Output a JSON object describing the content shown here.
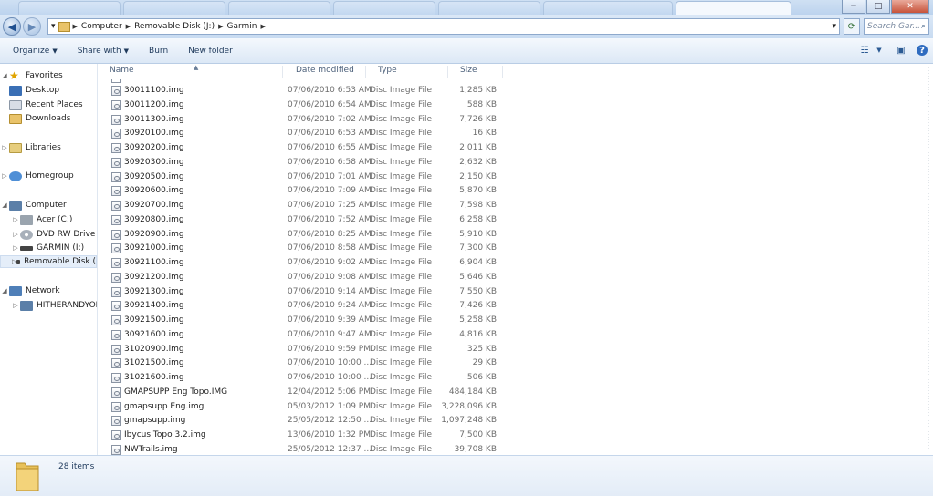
{
  "window": {
    "controls": {
      "minimize": "─",
      "maximize": "□",
      "close": "✕"
    }
  },
  "address": {
    "segments": [
      "Computer",
      "Removable Disk (J:)",
      "Garmin"
    ],
    "search_placeholder": "Search Gar..."
  },
  "toolbar": {
    "organize": "Organize",
    "share_with": "Share with",
    "burn": "Burn",
    "new_folder": "New folder"
  },
  "nav": {
    "favorites": "Favorites",
    "desktop": "Desktop",
    "recent_places": "Recent Places",
    "downloads": "Downloads",
    "libraries": "Libraries",
    "homegroup": "Homegroup",
    "computer": "Computer",
    "acer": "Acer (C:)",
    "dvd": "DVD RW Drive (D",
    "garmin": "GARMIN (I:)",
    "removable": "Removable Disk (",
    "network": "Network",
    "hitherandyon": "HITHERANDYON"
  },
  "columns": {
    "name": "Name",
    "date": "Date modified",
    "type": "Type",
    "size": "Size"
  },
  "files": [
    {
      "name": "30011100.img",
      "date": "07/06/2010 6:53 AM",
      "type": "Disc Image File",
      "size": "1,285 KB"
    },
    {
      "name": "30011200.img",
      "date": "07/06/2010 6:54 AM",
      "type": "Disc Image File",
      "size": "588 KB"
    },
    {
      "name": "30011300.img",
      "date": "07/06/2010 7:02 AM",
      "type": "Disc Image File",
      "size": "7,726 KB"
    },
    {
      "name": "30920100.img",
      "date": "07/06/2010 6:53 AM",
      "type": "Disc Image File",
      "size": "16 KB"
    },
    {
      "name": "30920200.img",
      "date": "07/06/2010 6:55 AM",
      "type": "Disc Image File",
      "size": "2,011 KB"
    },
    {
      "name": "30920300.img",
      "date": "07/06/2010 6:58 AM",
      "type": "Disc Image File",
      "size": "2,632 KB"
    },
    {
      "name": "30920500.img",
      "date": "07/06/2010 7:01 AM",
      "type": "Disc Image File",
      "size": "2,150 KB"
    },
    {
      "name": "30920600.img",
      "date": "07/06/2010 7:09 AM",
      "type": "Disc Image File",
      "size": "5,870 KB"
    },
    {
      "name": "30920700.img",
      "date": "07/06/2010 7:25 AM",
      "type": "Disc Image File",
      "size": "7,598 KB"
    },
    {
      "name": "30920800.img",
      "date": "07/06/2010 7:52 AM",
      "type": "Disc Image File",
      "size": "6,258 KB"
    },
    {
      "name": "30920900.img",
      "date": "07/06/2010 8:25 AM",
      "type": "Disc Image File",
      "size": "5,910 KB"
    },
    {
      "name": "30921000.img",
      "date": "07/06/2010 8:58 AM",
      "type": "Disc Image File",
      "size": "7,300 KB"
    },
    {
      "name": "30921100.img",
      "date": "07/06/2010 9:02 AM",
      "type": "Disc Image File",
      "size": "6,904 KB"
    },
    {
      "name": "30921200.img",
      "date": "07/06/2010 9:08 AM",
      "type": "Disc Image File",
      "size": "5,646 KB"
    },
    {
      "name": "30921300.img",
      "date": "07/06/2010 9:14 AM",
      "type": "Disc Image File",
      "size": "7,550 KB"
    },
    {
      "name": "30921400.img",
      "date": "07/06/2010 9:24 AM",
      "type": "Disc Image File",
      "size": "7,426 KB"
    },
    {
      "name": "30921500.img",
      "date": "07/06/2010 9:39 AM",
      "type": "Disc Image File",
      "size": "5,258 KB"
    },
    {
      "name": "30921600.img",
      "date": "07/06/2010 9:47 AM",
      "type": "Disc Image File",
      "size": "4,816 KB"
    },
    {
      "name": "31020900.img",
      "date": "07/06/2010 9:59 PM",
      "type": "Disc Image File",
      "size": "325 KB"
    },
    {
      "name": "31021500.img",
      "date": "07/06/2010 10:00 ...",
      "type": "Disc Image File",
      "size": "29 KB"
    },
    {
      "name": "31021600.img",
      "date": "07/06/2010 10:00 ...",
      "type": "Disc Image File",
      "size": "506 KB"
    },
    {
      "name": "GMAPSUPP Eng Topo.IMG",
      "date": "12/04/2012 5:06 PM",
      "type": "Disc Image File",
      "size": "484,184 KB"
    },
    {
      "name": "gmapsupp Eng.img",
      "date": "05/03/2012 1:09 PM",
      "type": "Disc Image File",
      "size": "3,228,096 KB"
    },
    {
      "name": "gmapsupp.img",
      "date": "25/05/2012 12:50 ...",
      "type": "Disc Image File",
      "size": "1,097,248 KB"
    },
    {
      "name": "Ibycus Topo 3.2.img",
      "date": "13/06/2010 1:32 PM",
      "type": "Disc Image File",
      "size": "7,500 KB"
    },
    {
      "name": "NWTrails.img",
      "date": "25/05/2012 12:37 ...",
      "type": "Disc Image File",
      "size": "39,708 KB"
    }
  ],
  "status": {
    "item_count": "28 items"
  }
}
